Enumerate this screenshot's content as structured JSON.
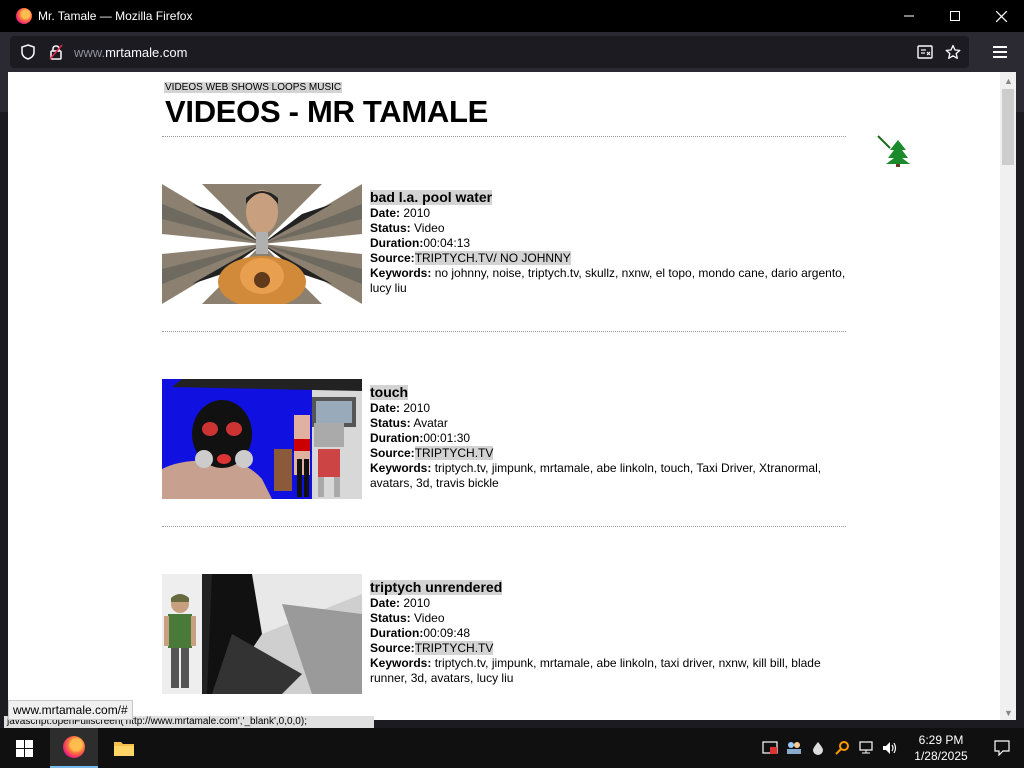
{
  "window": {
    "title": "Mr. Tamale — Mozilla Firefox",
    "minimize": "—",
    "maximize": "☐",
    "close": "✕"
  },
  "navbar": {
    "url_prefix": "www.",
    "url_domain": "mrtamale.com"
  },
  "page": {
    "topnav": "VIDEOS WEB SHOWS LOOPS MUSIC",
    "title": "VIDEOS - MR TAMALE",
    "entries": [
      {
        "title": "bad l.a. pool water",
        "date_label": "Date:",
        "date": "2010",
        "status_label": "Status:",
        "status": "Video",
        "duration_label": "Duration:",
        "duration": "00:04:13",
        "source_label": "Source:",
        "source": "TRIPTYCH.TV/ NO JOHNNY",
        "keywords_label": "Keywords:",
        "keywords": "no johnny, noise, triptych.tv, skullz, nxnw, el topo, mondo cane, dario argento, lucy liu"
      },
      {
        "title": "touch",
        "date_label": "Date:",
        "date": "2010",
        "status_label": "Status:",
        "status": "Avatar",
        "duration_label": "Duration:",
        "duration": "00:01:30",
        "source_label": "Source:",
        "source": "TRIPTYCH.TV",
        "keywords_label": "Keywords:",
        "keywords": "triptych.tv, jimpunk, mrtamale, abe linkoln, touch, Taxi Driver, Xtranormal, avatars, 3d, travis bickle"
      },
      {
        "title": "triptych unrendered",
        "date_label": "Date:",
        "date": "2010",
        "status_label": "Status:",
        "status": "Video",
        "duration_label": "Duration:",
        "duration": "00:09:48",
        "source_label": "Source:",
        "source": "TRIPTYCH.TV",
        "keywords_label": "Keywords:",
        "keywords": "triptych.tv, jimpunk, mrtamale, abe linkoln, taxi driver, nxnw, kill bill, blade runner, 3d, avatars, lucy liu"
      }
    ]
  },
  "statusbar": {
    "link": "www.mrtamale.com/#",
    "script": "javascript:openFullscreen('http://www.mrtamale.com','_blank',0,0,0);"
  },
  "taskbar": {
    "time": "6:29 PM",
    "date": "1/28/2025"
  },
  "colors": {
    "titlebar": "#000000",
    "navbar": "#2b2a33",
    "urlbar": "#1c1b22",
    "highlight": "#d3d3d3",
    "taskbar": "#101010"
  }
}
